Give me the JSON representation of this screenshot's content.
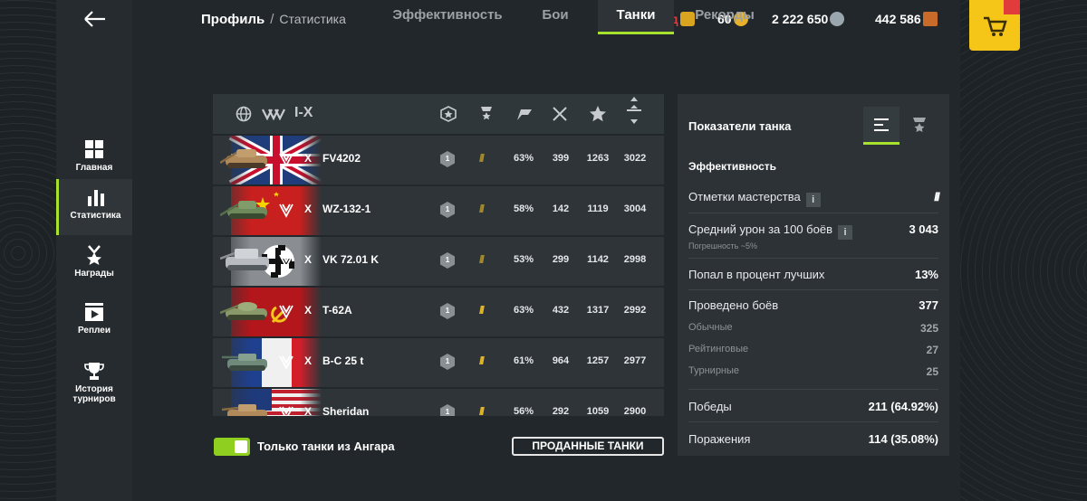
{
  "header": {
    "breadcrumb_main": "Профиль",
    "breadcrumb_sep": "/",
    "breadcrumb_current": "Статистика",
    "premium": "0д",
    "gold": "60",
    "credits": "2 222 650",
    "free_xp": "442 586"
  },
  "sidebar": {
    "items": [
      {
        "label": "Главная",
        "icon": "grid-icon"
      },
      {
        "label": "Статистика",
        "icon": "bar-chart-icon"
      },
      {
        "label": "Награды",
        "icon": "medal-icon"
      },
      {
        "label": "Реплеи",
        "icon": "replay-icon"
      },
      {
        "label": "История турниров",
        "icon": "trophy-icon"
      }
    ]
  },
  "tabs": [
    {
      "label": "Эффективность"
    },
    {
      "label": "Бои"
    },
    {
      "label": "Танки"
    },
    {
      "label": "Рекорды"
    }
  ],
  "table": {
    "tier_filter": "I-X",
    "rows": [
      {
        "tier": "X",
        "name": "FV4202",
        "mastery": "1",
        "marks": "///",
        "winrate": "63%",
        "battles": "399",
        "kills": "1263",
        "damage": "3022",
        "flag": "uk"
      },
      {
        "tier": "X",
        "name": "WZ-132-1",
        "mastery": "1",
        "marks": "///",
        "winrate": "58%",
        "battles": "142",
        "kills": "1119",
        "damage": "3004",
        "flag": "china"
      },
      {
        "tier": "X",
        "name": "VK 72.01 K",
        "mastery": "1",
        "marks": "///",
        "winrate": "53%",
        "battles": "299",
        "kills": "1142",
        "damage": "2998",
        "flag": "germany"
      },
      {
        "tier": "X",
        "name": "T-62A",
        "mastery": "1",
        "marks": "///",
        "winrate": "63%",
        "battles": "432",
        "kills": "1317",
        "damage": "2992",
        "flag": "ussr"
      },
      {
        "tier": "X",
        "name": "B-C 25 t",
        "mastery": "1",
        "marks": "///",
        "winrate": "61%",
        "battles": "964",
        "kills": "1257",
        "damage": "2977",
        "flag": "france"
      },
      {
        "tier": "X",
        "name": "Sheridan",
        "mastery": "1",
        "marks": "///",
        "winrate": "56%",
        "battles": "292",
        "kills": "1059",
        "damage": "2900",
        "flag": "usa"
      }
    ]
  },
  "bottom": {
    "toggle_label": "Только танки из Ангара",
    "sold_button": "ПРОДАННЫЕ ТАНКИ"
  },
  "stats": {
    "title": "Показатели танка",
    "section": "Эффективность",
    "mastery_label": "Отметки мастерства",
    "mastery_value": "///",
    "avg_damage_label": "Средний урон за 100 боёв",
    "avg_damage_value": "3 043",
    "avg_damage_note": "Погрешность ~5%",
    "top_label": "Попал в процент лучших",
    "top_value": "13%",
    "battles_label": "Проведено боёв",
    "battles_value": "377",
    "regular_label": "Обычные",
    "regular_value": "325",
    "rating_label": "Рейтинговые",
    "rating_value": "27",
    "tournament_label": "Турнирные",
    "tournament_value": "25",
    "wins_label": "Победы",
    "wins_value": "211 (64.92%)",
    "losses_label": "Поражения",
    "losses_value": "114 (35.08%)"
  },
  "colors": {
    "accent": "#a6e22e",
    "gold_marks": "#e0b62a",
    "premium_red": "#e23b3b",
    "shop_yellow": "#f5c518"
  }
}
